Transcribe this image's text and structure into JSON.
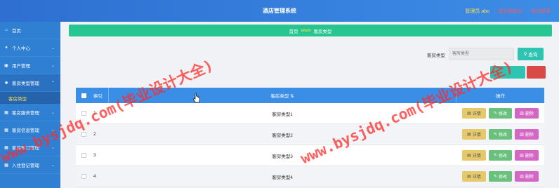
{
  "header": {
    "title": "酒店管理系统",
    "admin_label": "管理员 abo",
    "link_1": "退出到前台",
    "link_2": "退出登录"
  },
  "sidebar": {
    "items": [
      {
        "label": "首页",
        "icon": "home-icon"
      },
      {
        "label": "个人中心",
        "icon": "user-icon"
      },
      {
        "label": "用户管理",
        "icon": "users-icon"
      },
      {
        "label": "客房类型管理",
        "icon": "gear-icon"
      },
      {
        "label": "客房服务管理",
        "icon": "grid-icon"
      },
      {
        "label": "客房信息管理",
        "icon": "grid-icon"
      },
      {
        "label": "客房预订管理",
        "icon": "grid-icon"
      },
      {
        "label": "入住登记管理",
        "icon": "grid-icon"
      }
    ],
    "active_submenu": "客房类型"
  },
  "breadcrumb": {
    "home": "首页",
    "separator": "www",
    "current": "客房类型"
  },
  "search": {
    "label": "客房类型",
    "placeholder": "客房类型",
    "button_label": "查询"
  },
  "table": {
    "headers": {
      "index": "索引",
      "type": "客房类型",
      "operation": "操作"
    },
    "rows": [
      {
        "index": "1",
        "type": "客房类型1"
      },
      {
        "index": "2",
        "type": "客房类型2"
      },
      {
        "index": "3",
        "type": "客房类型3"
      },
      {
        "index": "4",
        "type": "客房类型4"
      }
    ],
    "actions": {
      "detail": "详情",
      "edit": "修改",
      "delete": "删除"
    }
  },
  "watermark": {
    "text_1": "www.bysjdq.com(毕业设计大全)",
    "text_2": "www.bysjdq.com(毕业设计大全)"
  },
  "colors": {
    "topbar": "#2e6fd1",
    "sidebar": "#2f7fd3",
    "breadcrumb": "#27c58f",
    "table_header": "#3a8ee6",
    "detail_btn": "#e6c96a",
    "edit_btn": "#6ac07d",
    "delete_btn": "#d567c4",
    "watermark": "#ff2a2a"
  }
}
